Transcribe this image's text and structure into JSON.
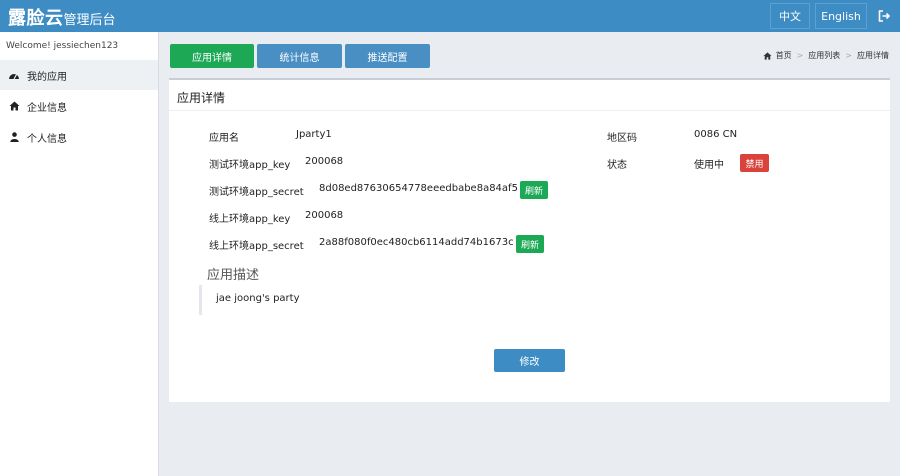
{
  "header": {
    "brand_main": "露脸云",
    "brand_sub": "管理后台",
    "lang_zh": "中文",
    "lang_en": "English",
    "logout_icon": "sign-out-icon"
  },
  "sidebar": {
    "welcome": "Welcome! jessiechen123",
    "items": [
      {
        "label": "我的应用",
        "icon": "dashboard-icon",
        "active": true
      },
      {
        "label": "企业信息",
        "icon": "home-icon",
        "active": false
      },
      {
        "label": "个人信息",
        "icon": "user-icon",
        "active": false
      }
    ]
  },
  "tabs": [
    {
      "label": "应用详情",
      "active": true
    },
    {
      "label": "统计信息",
      "active": false
    },
    {
      "label": "推送配置",
      "active": false
    }
  ],
  "breadcrumb": [
    "首页",
    "应用列表",
    "应用详情"
  ],
  "panel": {
    "title": "应用详情",
    "fields": {
      "app_name_label": "应用名",
      "app_name_value": "Jparty1",
      "region_label": "地区码",
      "region_value": "0086 CN",
      "test_key_label": "测试环境app_key",
      "test_key_value": "200068",
      "status_label": "状态",
      "status_value": "使用中",
      "status_button": "禁用",
      "test_secret_label": "测试环境app_secret",
      "test_secret_value": "8d08ed87630654778eeedbabe8a84af5",
      "refresh_label": "刷新",
      "prod_key_label": "线上环境app_key",
      "prod_key_value": "200068",
      "prod_secret_label": "线上环境app_secret",
      "prod_secret_value": "2a88f080f0ec480cb6114add74b1673c"
    },
    "description_title": "应用描述",
    "description_text": "jae joong's party",
    "edit_button": "修改"
  },
  "colors": {
    "header_blue": "#3d8cc4",
    "tab_green": "#1ca855",
    "tab_blue": "#4a8fc4",
    "disable_red": "#d9433b"
  }
}
